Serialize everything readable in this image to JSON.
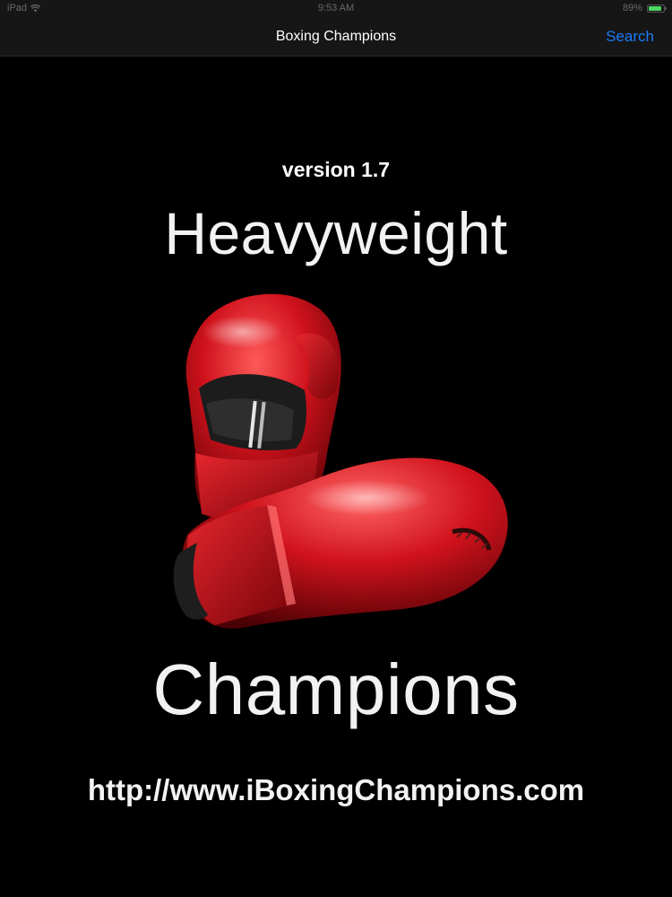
{
  "status_bar": {
    "carrier": "iPad",
    "time": "9:53 AM",
    "battery_text": "89%",
    "battery_level": 0.89,
    "battery_color": "#4cd964"
  },
  "nav": {
    "title": "Boxing Champions",
    "search_label": "Search",
    "accent_color": "#1a7cf5"
  },
  "splash": {
    "version": "version 1.7",
    "headline_top": "Heavyweight",
    "headline_bottom": "Champions",
    "url": "http://www.iBoxingChampions.com",
    "image_icon": "boxing-gloves-icon"
  },
  "colors": {
    "background": "#000000",
    "glove_red": "#d0121c"
  }
}
